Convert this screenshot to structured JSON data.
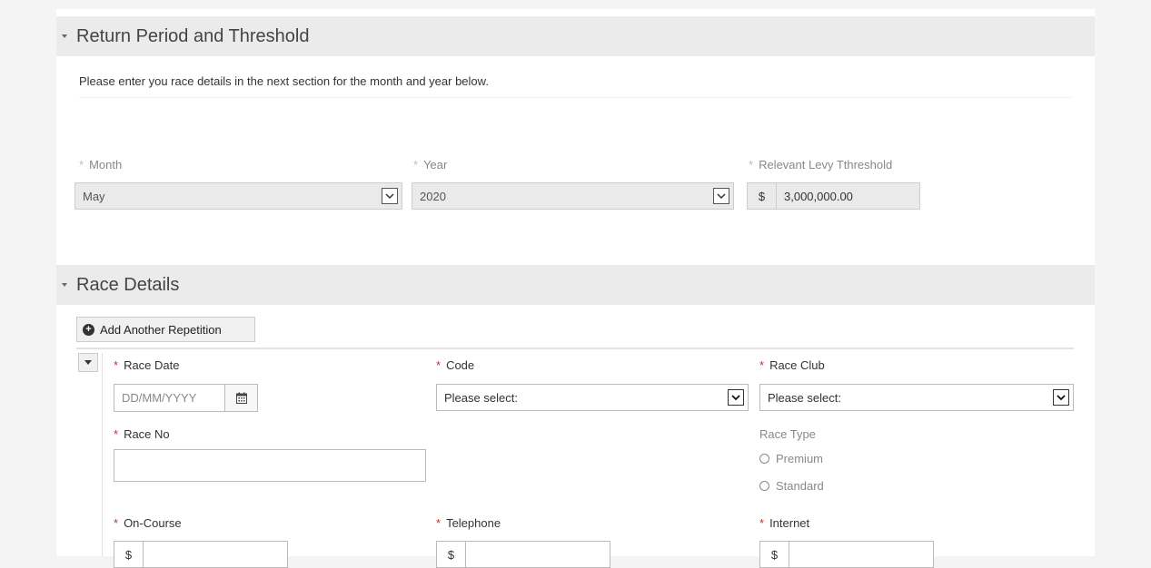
{
  "section1": {
    "title": "Return Period and Threshold",
    "intro": "Please enter you race details in the next section for the month and year below.",
    "month": {
      "label": "Month",
      "value": "May"
    },
    "year": {
      "label": "Year",
      "value": "2020"
    },
    "threshold": {
      "label": "Relevant Levy Tthreshold",
      "currency": "$",
      "value": "3,000,000.00"
    }
  },
  "section2": {
    "title": "Race Details",
    "add_button": "Add Another Repetition",
    "race_date": {
      "label": "Race Date",
      "placeholder": "DD/MM/YYYY"
    },
    "code": {
      "label": "Code",
      "value": "Please select:"
    },
    "race_club": {
      "label": "Race Club",
      "value": "Please select:"
    },
    "race_no": {
      "label": "Race No"
    },
    "race_type": {
      "label": "Race Type",
      "options": [
        "Premium",
        "Standard"
      ]
    },
    "on_course": {
      "label": "On-Course",
      "currency": "$"
    },
    "telephone": {
      "label": "Telephone",
      "currency": "$"
    },
    "internet": {
      "label": "Internet",
      "currency": "$"
    }
  },
  "required_mark": "*",
  "icons": {
    "section_toggle": "caret-down-icon",
    "add": "plus-circle-icon",
    "calendar": "calendar-icon",
    "dropdown": "chevron-down-icon",
    "collapse": "caret-down-icon"
  }
}
